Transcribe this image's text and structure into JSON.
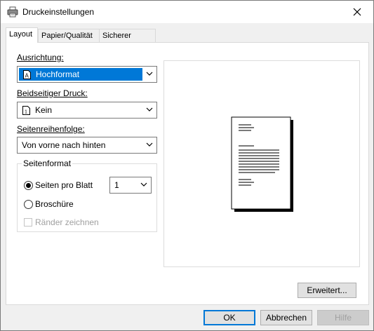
{
  "window": {
    "title": "Druckeinstellungen",
    "icons": {
      "app": "printer-icon",
      "close": "close-icon"
    }
  },
  "tabs": [
    {
      "label": "Layout",
      "active": true
    },
    {
      "label": "Papier/Qualität",
      "active": false
    },
    {
      "label": "Sicherer Druck",
      "active": false
    }
  ],
  "layout": {
    "orientation": {
      "label": "Ausrichtung:",
      "value": "Hochformat",
      "icon": "portrait-page-icon"
    },
    "duplex": {
      "label": "Beidseitiger Druck:",
      "value": "Kein",
      "icon": "single-page-icon"
    },
    "page_order": {
      "label": "Seitenreihenfolge:",
      "value": "Von vorne nach hinten"
    },
    "page_format": {
      "title": "Seitenformat",
      "pages_per_sheet_label": "Seiten pro Blatt",
      "pages_per_sheet_value": "1",
      "pages_per_sheet_selected": true,
      "booklet_label": "Broschüre",
      "booklet_selected": false,
      "draw_borders_label": "Ränder zeichnen",
      "draw_borders_checked": false,
      "draw_borders_enabled": false
    },
    "advanced_button": "Erweitert..."
  },
  "buttons": {
    "ok": "OK",
    "cancel": "Abbrechen",
    "help": "Hilfe"
  },
  "colors": {
    "accent": "#0078d7",
    "disabled": "#a0a0a0"
  }
}
